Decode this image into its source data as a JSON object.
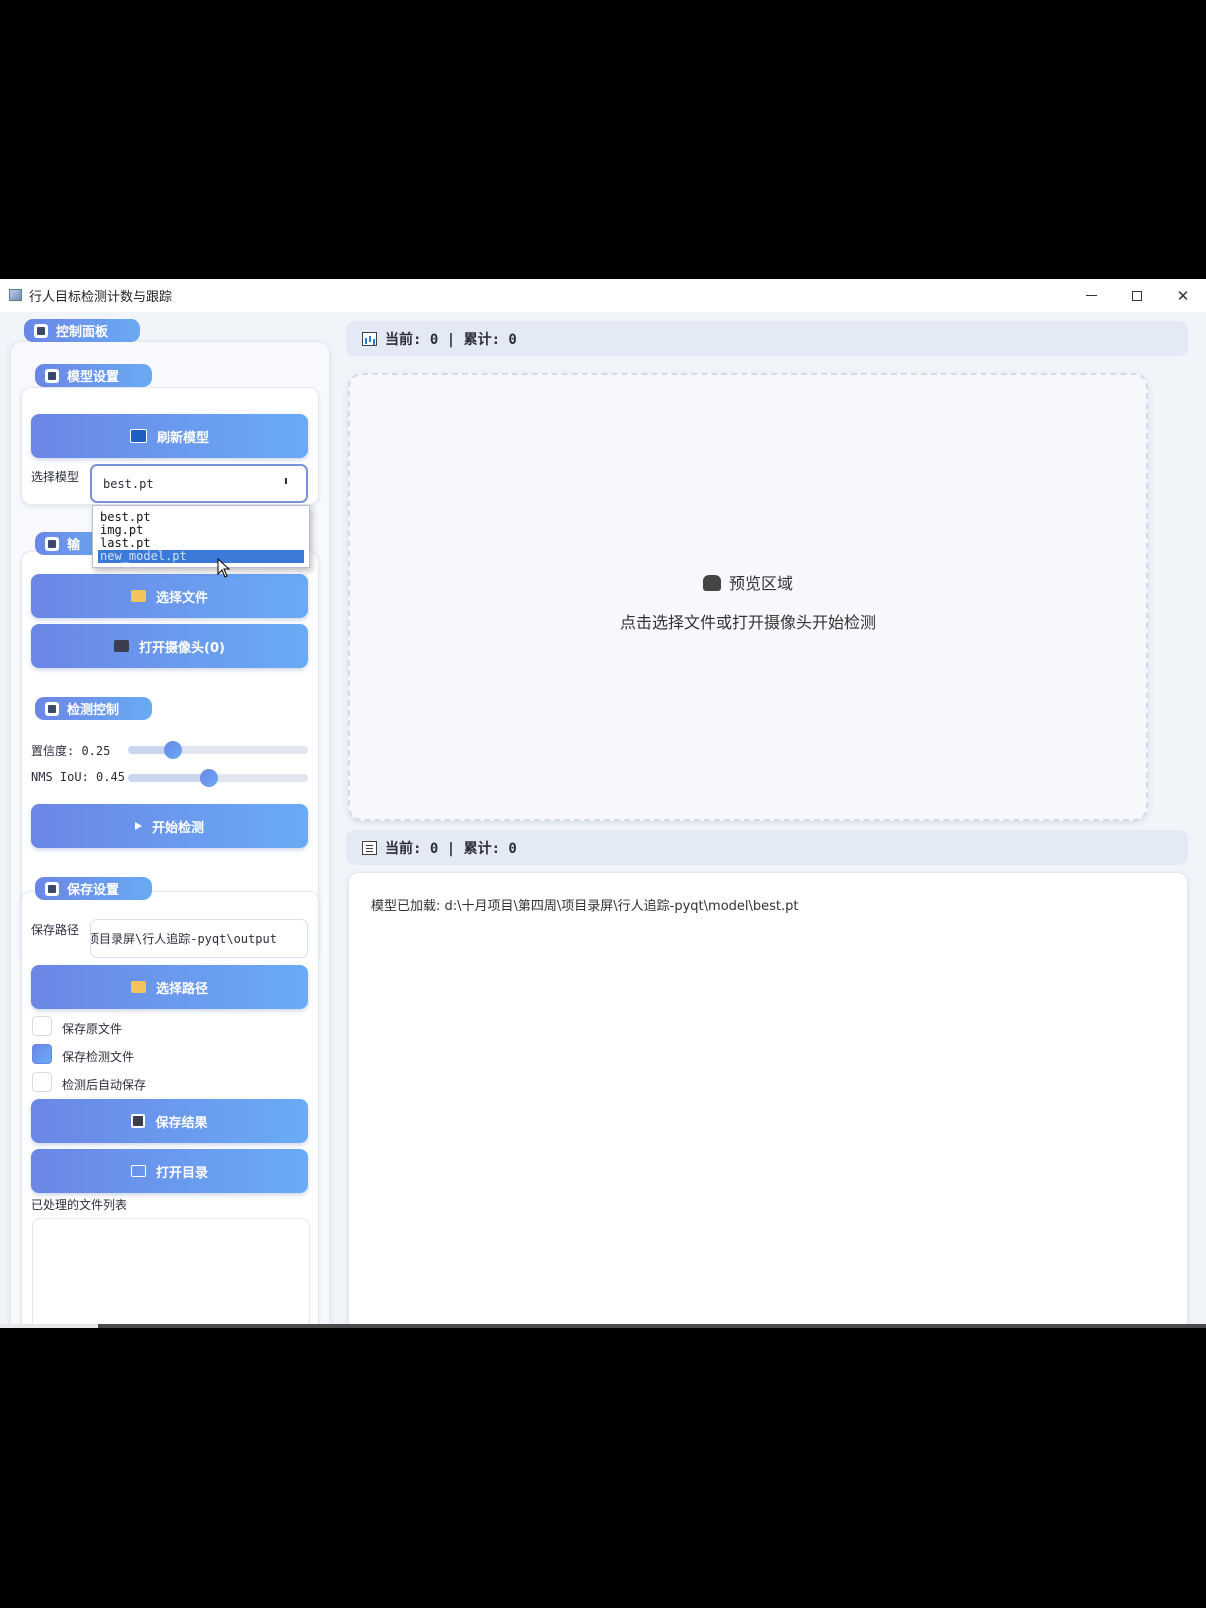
{
  "window": {
    "title": "行人目标检测计数与跟踪",
    "controls": {
      "minimize": "—",
      "maximize": "☐",
      "close": "✕"
    }
  },
  "control_panel": {
    "title": "控制面板"
  },
  "model_settings": {
    "title": "模型设置",
    "refresh_label": "刷新模型",
    "select_label": "选择模型",
    "selected_model": "best.pt",
    "options": [
      "best.pt",
      "img.pt",
      "last.pt",
      "new_model.pt"
    ],
    "highlighted_option": "new_model.pt"
  },
  "input_settings": {
    "title_visible": "输",
    "select_file_label": "选择文件",
    "open_camera_label": "打开摄像头(0)"
  },
  "detection_control": {
    "title": "检测控制",
    "confidence_label": "置信度: 0.25",
    "confidence_value": 0.25,
    "iou_label": "NMS IoU: 0.45",
    "iou_value": 0.45,
    "start_label": "开始检测"
  },
  "save_settings": {
    "title": "保存设置",
    "path_label": "保存路径",
    "path_value": "项目录屏\\行人追踪-pyqt\\output",
    "choose_path_label": "选择路径",
    "save_original": {
      "label": "保存原文件",
      "checked": false
    },
    "save_detected": {
      "label": "保存检测文件",
      "checked": true
    },
    "auto_save": {
      "label": "检测后自动保存",
      "checked": false
    },
    "save_results_label": "保存结果",
    "open_dir_label": "打开目录",
    "processed_list_label": "已处理的文件列表"
  },
  "preview": {
    "stats": "当前: 0 | 累计: 0",
    "title": "预览区域",
    "hint": "点击选择文件或打开摄像头开始检测"
  },
  "log": {
    "stats": "当前: 0 | 累计: 0",
    "line": "模型已加载: d:\\十月项目\\第四周\\项目录屏\\行人追踪-pyqt\\model\\best.pt"
  },
  "colors": {
    "accent_start": "#6b86e6",
    "accent_end": "#69abf5",
    "window_bg": "#f1f4f9"
  }
}
